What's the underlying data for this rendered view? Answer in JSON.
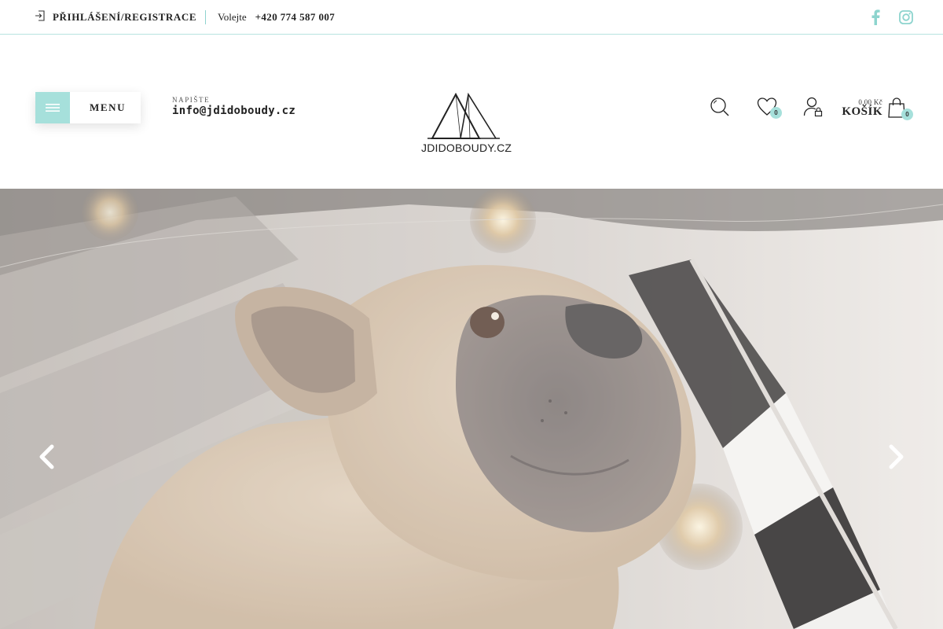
{
  "topbar": {
    "login_label": "PŘIHLÁŠENÍ/REGISTRACE",
    "call_label": "Volejte",
    "phone": "+420 774 587 007",
    "social": [
      "facebook-icon",
      "instagram-icon"
    ]
  },
  "header": {
    "menu_label": "MENU",
    "write_label": "NAPIŠTE",
    "email": "info@jdidoboudy.cz",
    "logo_text": "JDIDOBOUDY.CZ",
    "wishlist_count": "0",
    "cart": {
      "price": "0,00 Kč",
      "label": "KOŠÍK",
      "count": "0"
    }
  },
  "hero": {
    "image": "french-bulldog-in-striped-pet-tent",
    "prev_icon": "chevron-left-icon",
    "next_icon": "chevron-right-icon"
  },
  "colors": {
    "accent": "#a6e0db",
    "social": "#7fcfc9",
    "text": "#222222"
  }
}
